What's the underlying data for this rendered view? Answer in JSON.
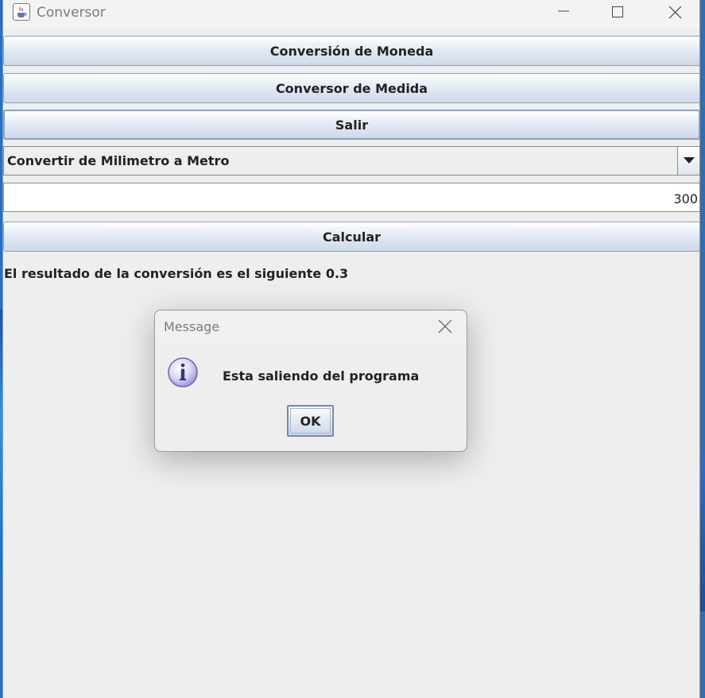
{
  "window": {
    "title": "Conversor",
    "icon": "java-cup-icon"
  },
  "buttons": {
    "currency": "Conversión de Moneda",
    "measure": "Conversor de Medida",
    "exit": "Salir",
    "calculate": "Calcular"
  },
  "combo": {
    "selected": "Convertir de Milimetro a Metro"
  },
  "input": {
    "value": "300"
  },
  "result": {
    "text": "El resultado de la conversión es el siguiente 0.3"
  },
  "dialog": {
    "title": "Message",
    "message": "Esta saliendo del programa",
    "ok_label": "OK",
    "icon": "info-icon"
  }
}
